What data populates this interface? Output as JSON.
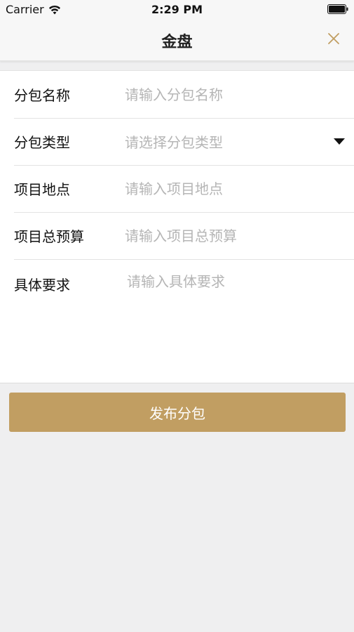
{
  "status_bar": {
    "carrier": "Carrier",
    "time": "2:29 PM"
  },
  "nav": {
    "title": "金盘",
    "close_icon": "close-icon"
  },
  "form": {
    "rows": [
      {
        "label": "分包名称",
        "placeholder": "请输入分包名称",
        "type": "text"
      },
      {
        "label": "分包类型",
        "placeholder": "请选择分包类型",
        "type": "select"
      },
      {
        "label": "项目地点",
        "placeholder": "请输入项目地点",
        "type": "text"
      },
      {
        "label": "项目总预算",
        "placeholder": "请输入项目总预算",
        "type": "text"
      },
      {
        "label": "具体要求",
        "placeholder": "请输入具体要求",
        "type": "textarea"
      }
    ]
  },
  "submit": {
    "label": "发布分包"
  },
  "colors": {
    "accent": "#c19e62",
    "background": "#efeff0",
    "placeholder": "#b5b5b5"
  }
}
